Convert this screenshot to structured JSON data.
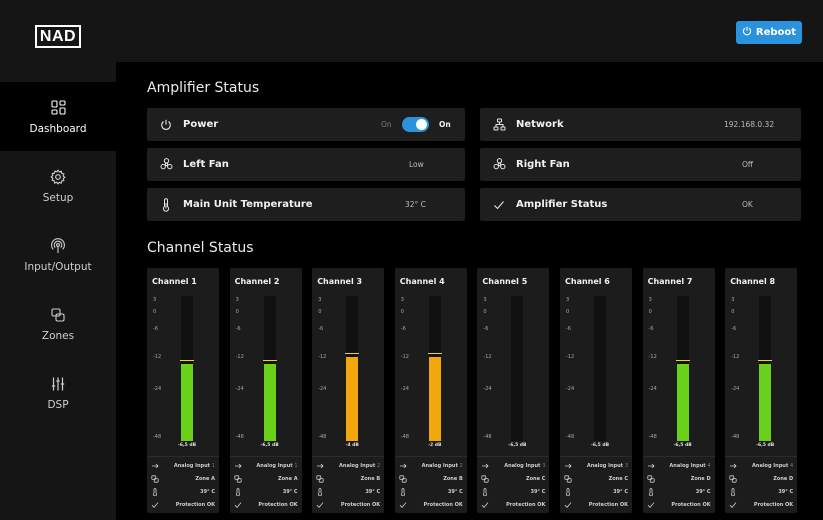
{
  "app": {
    "logo": "NAD"
  },
  "sidebar": {
    "items": [
      {
        "label": "Dashboard",
        "icon": "dashboard-icon",
        "active": true
      },
      {
        "label": "Setup",
        "icon": "gear-icon",
        "active": false
      },
      {
        "label": "Input/Output",
        "icon": "signal-icon",
        "active": false
      },
      {
        "label": "Zones",
        "icon": "zones-icon",
        "active": false
      },
      {
        "label": "DSP",
        "icon": "sliders-icon",
        "active": false
      }
    ]
  },
  "header": {
    "reboot_label": "Reboot"
  },
  "amplifier_status": {
    "title": "Amplifier Status",
    "power": {
      "label": "Power",
      "state_text": "On",
      "value": "On",
      "toggle_on": true
    },
    "network": {
      "label": "Network",
      "value": "192.168.0.32"
    },
    "left_fan": {
      "label": "Left Fan",
      "value": "Low"
    },
    "right_fan": {
      "label": "Right Fan",
      "value": "Off"
    },
    "temperature": {
      "label": "Main Unit Temperature",
      "value": "32° C"
    },
    "amp_status": {
      "label": "Amplifier Status",
      "value": "OK"
    }
  },
  "channel_status": {
    "title": "Channel Status",
    "scale_ticks": [
      "3",
      "0",
      "-6",
      "-12",
      "-24",
      "-48"
    ],
    "channels": [
      {
        "name": "Channel 1",
        "db": "-6,5 dB",
        "level": 0.78,
        "peak": 0.79,
        "color": "#6ad11a",
        "input": "Analog Input",
        "input_num": "1",
        "zone": "Zone A",
        "temp": "39° C",
        "status": "Protection OK"
      },
      {
        "name": "Channel 2",
        "db": "-6,5 dB",
        "level": 0.78,
        "peak": 0.79,
        "color": "#6ad11a",
        "input": "Analog Input",
        "input_num": "1",
        "zone": "Zone A",
        "temp": "39° C",
        "status": "Protection OK"
      },
      {
        "name": "Channel 3",
        "db": "-4 dB",
        "level": 0.85,
        "peak": 0.86,
        "color": "#f2a80c",
        "input": "Analog Input",
        "input_num": "2",
        "zone": "Zone B",
        "temp": "39° C",
        "status": "Protection OK"
      },
      {
        "name": "Channel 4",
        "db": "-2 dB",
        "level": 0.85,
        "peak": 0.86,
        "color": "#f2a80c",
        "input": "Analog Input",
        "input_num": "2",
        "zone": "Zone B",
        "temp": "39° C",
        "status": "Protection OK"
      },
      {
        "name": "Channel 5",
        "db": "-6,5 dB",
        "level": 0,
        "peak": 0,
        "color": "#6ad11a",
        "input": "Analog Input",
        "input_num": "3",
        "zone": "Zone C",
        "temp": "39° C",
        "status": "Protection OK"
      },
      {
        "name": "Channel 6",
        "db": "-6,5 dB",
        "level": 0,
        "peak": 0,
        "color": "#6ad11a",
        "input": "Analog Input",
        "input_num": "3",
        "zone": "Zone C",
        "temp": "39° C",
        "status": "Protection OK"
      },
      {
        "name": "Channel 7",
        "db": "-6,5 dB",
        "level": 0.78,
        "peak": 0.79,
        "color": "#6ad11a",
        "input": "Analog Input",
        "input_num": "4",
        "zone": "Zone D",
        "temp": "39° C",
        "status": "Protection OK"
      },
      {
        "name": "Channel 8",
        "db": "-6,5 dB",
        "level": 0.78,
        "peak": 0.79,
        "color": "#6ad11a",
        "input": "Analog Input",
        "input_num": "4",
        "zone": "Zone D",
        "temp": "39° C",
        "status": "Protection OK"
      }
    ]
  },
  "colors": {
    "accent": "#2b93dd",
    "meter_green": "#6ad11a",
    "meter_orange": "#f2a80c",
    "peak_line": "#f5d21a"
  }
}
